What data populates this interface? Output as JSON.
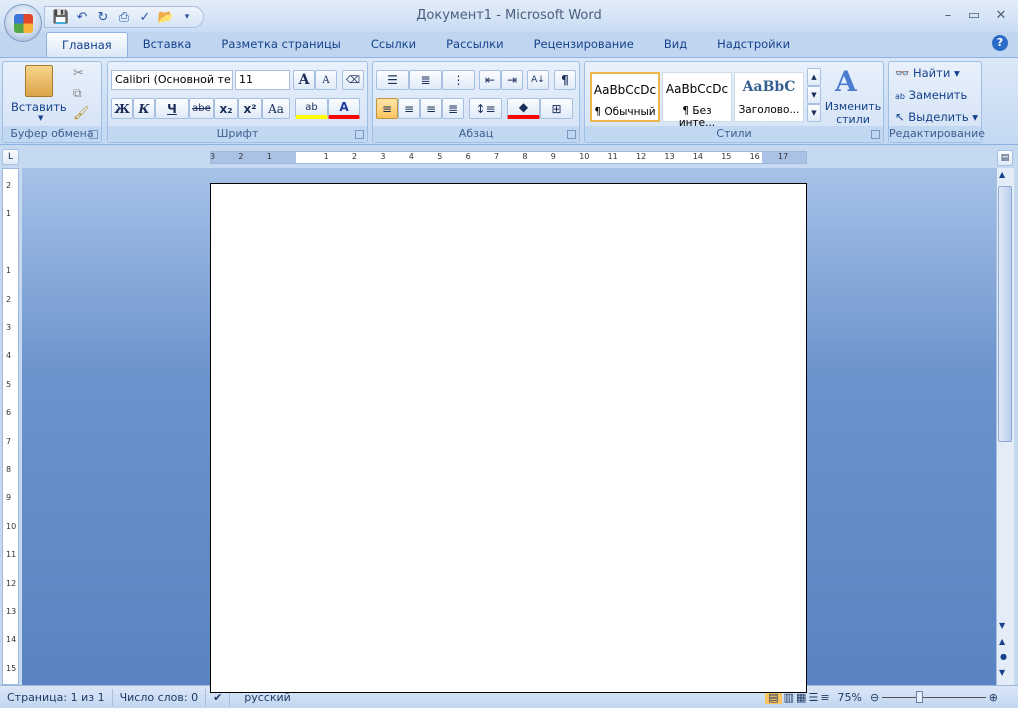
{
  "window": {
    "title": "Документ1 - Microsoft Word",
    "minimize": "–",
    "maximize": "▭",
    "close": "✕"
  },
  "qat": {
    "icons": [
      "save-icon",
      "undo-icon",
      "redo-icon",
      "print-icon",
      "spelling-icon",
      "open-icon"
    ]
  },
  "tabs": [
    "Главная",
    "Вставка",
    "Разметка страницы",
    "Ссылки",
    "Рассылки",
    "Рецензирование",
    "Вид",
    "Надстройки"
  ],
  "help": "?",
  "clipboard": {
    "paste": "Вставить",
    "label": "Буфер обмена"
  },
  "font": {
    "name": "Calibri (Основной те",
    "size": "11",
    "grow": "A",
    "shrink": "A",
    "bold": "Ж",
    "italic": "К",
    "underline": "Ч",
    "strike": "abe",
    "sub": "x₂",
    "sup": "x²",
    "case": "Aa",
    "highlight": "ab",
    "color": "A",
    "label": "Шрифт",
    "highlight_color": "#ffff00",
    "font_color": "#ff0000"
  },
  "paragraph": {
    "label": "Абзац",
    "pilcrow": "¶"
  },
  "styles": {
    "items": [
      {
        "preview": "AaBbCcDc",
        "name": "¶ Обычный"
      },
      {
        "preview": "AaBbCcDc",
        "name": "¶ Без инте..."
      },
      {
        "preview": "AaBbC",
        "name": "Заголово..."
      }
    ],
    "change": "Изменить стили",
    "label": "Стили"
  },
  "editing": {
    "find": "Найти",
    "replace": "Заменить",
    "select": "Выделить",
    "label": "Редактирование"
  },
  "ruler": {
    "h": [
      "3",
      "2",
      "1",
      "",
      "1",
      "2",
      "3",
      "4",
      "5",
      "6",
      "7",
      "8",
      "9",
      "10",
      "11",
      "12",
      "13",
      "14",
      "15",
      "16",
      "17"
    ],
    "v": [
      "2",
      "1",
      "",
      "1",
      "2",
      "3",
      "4",
      "5",
      "6",
      "7",
      "8",
      "9",
      "10",
      "11",
      "12",
      "13",
      "14",
      "15"
    ]
  },
  "status": {
    "page": "Страница: 1 из 1",
    "words": "Число слов: 0",
    "language": "русский",
    "zoom": "75%",
    "zoom_percent": 75
  }
}
